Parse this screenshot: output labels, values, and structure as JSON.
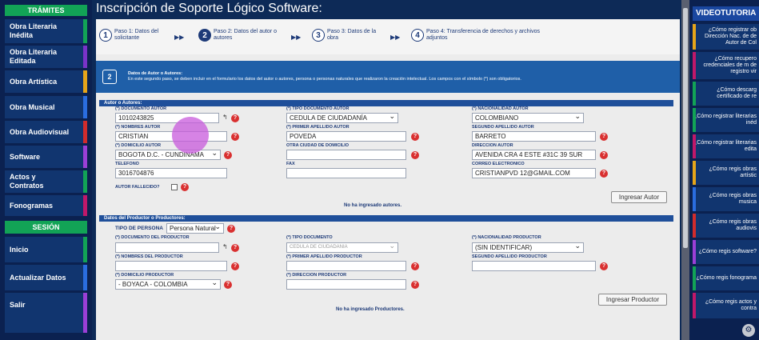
{
  "sidebar": {
    "tramites_heading": "TRÁMITES",
    "items": [
      {
        "label": "Obra Literaria Inédita",
        "color": "#12a356"
      },
      {
        "label": "Obra Literaria Editada",
        "color": "#7a33c9"
      },
      {
        "label": "Obra Artística",
        "color": "#e6a51a"
      },
      {
        "label": "Obra Musical",
        "color": "#2a6de0"
      },
      {
        "label": "Obra Audiovisual",
        "color": "#d12c2c"
      },
      {
        "label": "Software",
        "color": "#9b3fd6"
      },
      {
        "label": "Actos y Contratos",
        "color": "#12a356"
      },
      {
        "label": "Fonogramas",
        "color": "#c0186a"
      }
    ],
    "sesion_heading": "SESIÓN",
    "session_items": [
      {
        "label": "Inicio",
        "color": "#12a356"
      },
      {
        "label": "Actualizar Datos",
        "color": "#2a6de0"
      },
      {
        "label": "Salir",
        "color": "#9b3fd6"
      }
    ]
  },
  "page": {
    "title": "Inscripción de Soporte Lógico Software:"
  },
  "steps": [
    {
      "num": "1",
      "label": "Paso 1: Datos del solicitante"
    },
    {
      "num": "2",
      "label": "Paso 2: Datos del autor o autores"
    },
    {
      "num": "3",
      "label": "Paso 3: Datos de la obra"
    },
    {
      "num": "4",
      "label": "Paso 4: Transferencia de derechos y archivos adjuntos"
    }
  ],
  "info": {
    "badge": "2",
    "title": "Datos de Autor o Autores:",
    "text": "En este segundo paso, se deben incluir en el formulario los datos del autor o autores, persona o personas naturales que realizaron la creación intelectual. Los campos con el símbolo (*) son obligatorios."
  },
  "author": {
    "section_title": "Autor o Autores:",
    "doc_label": "(*) DOCUMENTO AUTOR",
    "doc_value": "1010243825",
    "tipo_doc_label": "(*) TIPO DOCUMENTO AUTOR",
    "tipo_doc_value": "CEDULA DE CIUDADANÍA",
    "nacionalidad_label": "(*) NACIONALIDAD AUTOR",
    "nacionalidad_value": "COLOMBIANO",
    "nombres_label": "(*) NOMBRES AUTOR",
    "nombres_value": "CRISTIAN",
    "primer_apellido_label": "(*) PRIMER APELLIDO AUTOR",
    "primer_apellido_value": "POVEDA",
    "segundo_apellido_label": "SEGUNDO APELLIDO AUTOR",
    "segundo_apellido_value": "BARRETO",
    "domicilio_label": "(*) DOMICILIO AUTOR",
    "domicilio_value": "BOGOTA D.C. - CUNDINAMA",
    "otra_ciudad_label": "OTRA CIUDAD DE DOMICILIO",
    "otra_ciudad_value": "",
    "direccion_label": "DIRECCION AUTOR",
    "direccion_value": "AVENIDA CRA 4 ESTE #31C 39 SUR",
    "telefono_label": "TELEFONO",
    "telefono_value": "3016704876",
    "fax_label": "FAX",
    "fax_value": "",
    "correo_label": "CORREO ELECTRONICO",
    "correo_value": "CRISTIANPVD 12@GMAIL.COM",
    "fallecido_label": "AUTOR FALLECIDO?",
    "ingresar_button": "Ingresar Autor",
    "empty_note": "No ha ingresado autores."
  },
  "producer": {
    "section_title": "Datos del Productor o Productores:",
    "tipo_persona_label": "TIPO DE PERSONA",
    "tipo_persona_value": "Persona Natural",
    "doc_label": "(*) DOCUMENTO DEL PRODUCTOR",
    "doc_value": "",
    "tipo_doc_label": "(*) TIPO DOCUMENTO",
    "tipo_doc_value": "CEDULA DE CIUDADANIA",
    "nacionalidad_label": "(*) NACIONALIDAD PRODUCTOR",
    "nacionalidad_value": "(SIN IDENTIFICAR)",
    "nombres_label": "(*) NOMBRES DEL PRODUCTOR",
    "nombres_value": "",
    "primer_apellido_label": "(*) PRIMER APELLIDO PRODUCTOR",
    "primer_apellido_value": "",
    "segundo_apellido_label": "SEGUNDO APELLIDO PRODUCTOR",
    "segundo_apellido_value": "",
    "domicilio_label": "(*) DOMICILIO PRODUCTOR",
    "domicilio_value": "- BOYACA - COLOMBIA",
    "direccion_label": "(*) DIRECCION PRODUCTOR",
    "direccion_value": "",
    "ingresar_button": "Ingresar Productor",
    "empty_note": "No ha ingresado Productores."
  },
  "right": {
    "heading": "VIDEOTUTORIA",
    "videos": [
      {
        "text": "¿Cómo registrar ob Dirección Nac. de de Autor de Col",
        "color": "#e6a51a"
      },
      {
        "text": "¿Cómo recupero credenciales de m de registro vir",
        "color": "#c0186a"
      },
      {
        "text": "¿Cómo descarg certificado de re",
        "color": "#12a356"
      },
      {
        "text": "¿Cómo registrar literarias inéd",
        "color": "#12a356"
      },
      {
        "text": "¿Cómo registrar literarias edita",
        "color": "#c0186a"
      },
      {
        "text": "¿Cómo regis obras artístic",
        "color": "#e6a51a"
      },
      {
        "text": "¿Cómo regis obras musica",
        "color": "#2a6de0"
      },
      {
        "text": "¿Cómo regis obras audiovis",
        "color": "#d12c2c"
      },
      {
        "text": "¿Cómo regis software?",
        "color": "#9b3fd6"
      },
      {
        "text": "¿Cómo regis fonograma",
        "color": "#12a356"
      },
      {
        "text": "¿Cómo regis actos y contra",
        "color": "#c0186a"
      }
    ]
  },
  "colors": {
    "accent": "#1f4f9a",
    "required": "#d93030"
  }
}
